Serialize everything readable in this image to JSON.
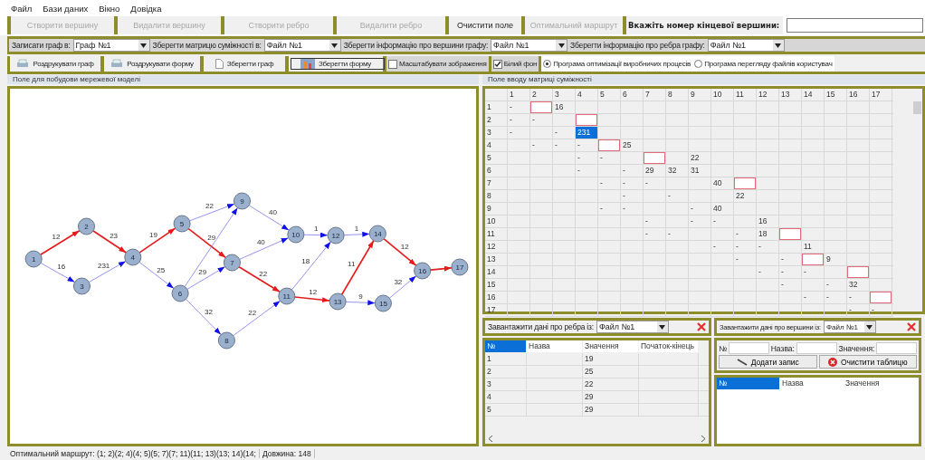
{
  "menu": [
    "Файл",
    "Бази даних",
    "Вікно",
    "Довідка"
  ],
  "toolbar": {
    "buttons": [
      {
        "label": "Створити вершину",
        "disabled": true
      },
      {
        "label": "Видалити вершину",
        "disabled": true
      },
      {
        "label": "Створити ребро",
        "disabled": true
      },
      {
        "label": "Видалити ребро",
        "disabled": true
      },
      {
        "label": "Очистити поле",
        "disabled": false
      },
      {
        "label": "Оптимальний маршрут",
        "disabled": true
      }
    ],
    "target_label": "Вкажіть номер кінцевої вершини:"
  },
  "save_bar": [
    {
      "label": "Записати граф в:",
      "value": "Граф №1"
    },
    {
      "label": "Зберегти матрицю суміжності в:",
      "value": "Файл №1"
    },
    {
      "label": "Зберегти інформацію про вершини графу:",
      "value": "Файл №1"
    },
    {
      "label": "Зберегти інформацію про ребра графу:",
      "value": "Файл №1"
    }
  ],
  "actions": [
    {
      "kind": "print",
      "label": "Роздрукувати граф",
      "pressed": false
    },
    {
      "kind": "print",
      "label": "Роздрукувати форму",
      "pressed": false
    },
    {
      "kind": "document",
      "label": "Зберегти граф",
      "pressed": false
    },
    {
      "kind": "image",
      "label": "Зберегти форму",
      "pressed": true
    }
  ],
  "options": [
    {
      "kind": "checkbox",
      "label": "Масштабувати зображення",
      "checked": false
    },
    {
      "kind": "checkbox",
      "label": "Білий фон",
      "checked": true
    },
    {
      "kind": "radio",
      "label": "Програма оптимізації виробничих процесів",
      "selected": true
    },
    {
      "kind": "radio",
      "label": "Програма перегляду файлів користувач",
      "selected": false
    }
  ],
  "graph_panel": {
    "caption": "Поле для побудови мережевої моделі",
    "nodes": [
      {
        "label": "1"
      },
      {
        "label": "2"
      },
      {
        "label": "3"
      },
      {
        "label": "4"
      },
      {
        "label": "5"
      },
      {
        "label": "6"
      },
      {
        "label": "7"
      },
      {
        "label": "8"
      },
      {
        "label": "9"
      },
      {
        "label": "10"
      },
      {
        "label": "11"
      },
      {
        "label": "12"
      },
      {
        "label": "13"
      },
      {
        "label": "14"
      },
      {
        "label": "15"
      },
      {
        "label": "16"
      },
      {
        "label": "17"
      }
    ],
    "edges": [
      {
        "weight": "12",
        "on_route": true
      },
      {
        "weight": "16",
        "on_route": false
      },
      {
        "weight": "23",
        "on_route": true
      },
      {
        "weight": "231",
        "on_route": false
      },
      {
        "weight": "19",
        "on_route": true
      },
      {
        "weight": "25",
        "on_route": false
      },
      {
        "weight": "22",
        "on_route": false
      },
      {
        "weight": "29",
        "on_route": true
      },
      {
        "on_route": false
      },
      {
        "weight": "29",
        "on_route": false
      },
      {
        "weight": "32",
        "on_route": false
      },
      {
        "weight": "40",
        "on_route": false
      },
      {
        "weight": "22",
        "on_route": true
      },
      {
        "weight": "40",
        "on_route": false
      },
      {
        "weight": "22",
        "on_route": false
      },
      {
        "weight": "1",
        "on_route": false
      },
      {
        "weight": "18",
        "on_route": false
      },
      {
        "weight": "12",
        "on_route": true
      },
      {
        "weight": "1",
        "on_route": false
      },
      {
        "weight": "11",
        "on_route": true
      },
      {
        "weight": "9",
        "on_route": false
      },
      {
        "weight": "12",
        "on_route": true
      },
      {
        "weight": "32",
        "on_route": false
      },
      {
        "on_route": true
      }
    ]
  },
  "matrix_panel": {
    "caption": "Поле вводу матриці суміжності",
    "columns": [
      "1",
      "2",
      "3",
      "4",
      "5",
      "6",
      "7",
      "8",
      "9",
      "10",
      "11",
      "12",
      "13",
      "14",
      "15",
      "16",
      "17"
    ],
    "rows": [
      {
        "label": "1",
        "cells": [
          {
            "kind": "text",
            "text": "-"
          },
          {
            "kind": "marked"
          },
          {
            "kind": "text",
            "text": "16"
          },
          null,
          null,
          null,
          null,
          null,
          null,
          null,
          null,
          null,
          null,
          null,
          null,
          null,
          null
        ]
      },
      {
        "label": "2",
        "cells": [
          {
            "kind": "text",
            "text": "-"
          },
          {
            "kind": "text",
            "text": "-"
          },
          null,
          {
            "kind": "marked"
          },
          null,
          null,
          null,
          null,
          null,
          null,
          null,
          null,
          null,
          null,
          null,
          null,
          null
        ]
      },
      {
        "label": "3",
        "cells": [
          {
            "kind": "text",
            "text": "-"
          },
          null,
          {
            "kind": "text",
            "text": "-"
          },
          {
            "kind": "selected",
            "text": "231"
          },
          null,
          null,
          null,
          null,
          null,
          null,
          null,
          null,
          null,
          null,
          null,
          null,
          null
        ]
      },
      {
        "label": "4",
        "cells": [
          null,
          {
            "kind": "text",
            "text": "-"
          },
          {
            "kind": "text",
            "text": "-"
          },
          {
            "kind": "text",
            "text": "-"
          },
          {
            "kind": "marked"
          },
          {
            "kind": "text",
            "text": "25"
          },
          null,
          null,
          null,
          null,
          null,
          null,
          null,
          null,
          null,
          null,
          null
        ]
      },
      {
        "label": "5",
        "cells": [
          null,
          null,
          null,
          {
            "kind": "text",
            "text": "-"
          },
          {
            "kind": "text",
            "text": "-"
          },
          null,
          {
            "kind": "marked"
          },
          null,
          {
            "kind": "text",
            "text": "22"
          },
          null,
          null,
          null,
          null,
          null,
          null,
          null,
          null
        ]
      },
      {
        "label": "6",
        "cells": [
          null,
          null,
          null,
          {
            "kind": "text",
            "text": "-"
          },
          null,
          {
            "kind": "text",
            "text": "-"
          },
          {
            "kind": "text",
            "text": "29"
          },
          {
            "kind": "text",
            "text": "32"
          },
          {
            "kind": "text",
            "text": "31"
          },
          null,
          null,
          null,
          null,
          null,
          null,
          null,
          null
        ]
      },
      {
        "label": "7",
        "cells": [
          null,
          null,
          null,
          null,
          {
            "kind": "text",
            "text": "-"
          },
          {
            "kind": "text",
            "text": "-"
          },
          {
            "kind": "text",
            "text": "-"
          },
          null,
          null,
          {
            "kind": "text",
            "text": "40"
          },
          {
            "kind": "marked"
          },
          null,
          null,
          null,
          null,
          null,
          null
        ]
      },
      {
        "label": "8",
        "cells": [
          null,
          null,
          null,
          null,
          null,
          {
            "kind": "text",
            "text": "-"
          },
          null,
          {
            "kind": "text",
            "text": "-"
          },
          null,
          null,
          {
            "kind": "text",
            "text": "22"
          },
          null,
          null,
          null,
          null,
          null,
          null
        ]
      },
      {
        "label": "9",
        "cells": [
          null,
          null,
          null,
          null,
          {
            "kind": "text",
            "text": "-"
          },
          {
            "kind": "text",
            "text": "-"
          },
          null,
          null,
          {
            "kind": "text",
            "text": "-"
          },
          {
            "kind": "text",
            "text": "40"
          },
          null,
          null,
          null,
          null,
          null,
          null,
          null
        ]
      },
      {
        "label": "10",
        "cells": [
          null,
          null,
          null,
          null,
          null,
          null,
          {
            "kind": "text",
            "text": "-"
          },
          null,
          {
            "kind": "text",
            "text": "-"
          },
          {
            "kind": "text",
            "text": "-"
          },
          null,
          {
            "kind": "text",
            "text": "16"
          },
          null,
          null,
          null,
          null,
          null
        ]
      },
      {
        "label": "11",
        "cells": [
          null,
          null,
          null,
          null,
          null,
          null,
          {
            "kind": "text",
            "text": "-"
          },
          {
            "kind": "text",
            "text": "-"
          },
          null,
          null,
          {
            "kind": "text",
            "text": "-"
          },
          {
            "kind": "text",
            "text": "18"
          },
          {
            "kind": "marked"
          },
          null,
          null,
          null,
          null
        ]
      },
      {
        "label": "12",
        "cells": [
          null,
          null,
          null,
          null,
          null,
          null,
          null,
          null,
          null,
          {
            "kind": "text",
            "text": "-"
          },
          {
            "kind": "text",
            "text": "-"
          },
          {
            "kind": "text",
            "text": "-"
          },
          null,
          {
            "kind": "text",
            "text": "11"
          },
          null,
          null,
          null
        ]
      },
      {
        "label": "13",
        "cells": [
          null,
          null,
          null,
          null,
          null,
          null,
          null,
          null,
          null,
          null,
          {
            "kind": "text",
            "text": "-"
          },
          null,
          {
            "kind": "text",
            "text": "-"
          },
          {
            "kind": "marked"
          },
          {
            "kind": "text",
            "text": "9"
          },
          null,
          null
        ]
      },
      {
        "label": "14",
        "cells": [
          null,
          null,
          null,
          null,
          null,
          null,
          null,
          null,
          null,
          null,
          null,
          {
            "kind": "text",
            "text": "-"
          },
          {
            "kind": "text",
            "text": "-"
          },
          {
            "kind": "text",
            "text": "-"
          },
          null,
          {
            "kind": "marked"
          },
          null
        ]
      },
      {
        "label": "15",
        "cells": [
          null,
          null,
          null,
          null,
          null,
          null,
          null,
          null,
          null,
          null,
          null,
          null,
          {
            "kind": "text",
            "text": "-"
          },
          null,
          {
            "kind": "text",
            "text": "-"
          },
          {
            "kind": "text",
            "text": "32"
          },
          null
        ]
      },
      {
        "label": "16",
        "cells": [
          null,
          null,
          null,
          null,
          null,
          null,
          null,
          null,
          null,
          null,
          null,
          null,
          null,
          {
            "kind": "text",
            "text": "-"
          },
          {
            "kind": "text",
            "text": "-"
          },
          {
            "kind": "text",
            "text": "-"
          },
          {
            "kind": "marked"
          }
        ]
      },
      {
        "label": "17",
        "cells": [
          null,
          null,
          null,
          null,
          null,
          null,
          null,
          null,
          null,
          null,
          null,
          null,
          null,
          null,
          null,
          {
            "kind": "text",
            "text": "-"
          },
          {
            "kind": "text",
            "text": "-"
          }
        ]
      }
    ]
  },
  "edges_panel": {
    "load_label": "Завантажити дані про ребра із:",
    "file": "Файл №1",
    "columns": [
      "№",
      "Назва",
      "Значення",
      "Початок-кінець"
    ],
    "rows": [
      {
        "number": "1",
        "value": "19"
      },
      {
        "number": "2",
        "value": "25"
      },
      {
        "number": "3",
        "value": "22"
      },
      {
        "number": "4",
        "value": "29"
      },
      {
        "number": "5",
        "value": "29"
      }
    ]
  },
  "vertices_panel": {
    "load_label": "Завантажити дані про вершини із:",
    "file": "Файл №1",
    "fields": [
      "№",
      "Назва:",
      "Значення:"
    ],
    "buttons": [
      {
        "kind": "add",
        "label": "Додати запис"
      },
      {
        "kind": "clear",
        "label": "Очистити таблицю"
      }
    ],
    "columns": [
      "№",
      "Назва",
      "Значення"
    ]
  },
  "status_bar": {
    "route": "Оптимальний маршрут: (1; 2)(2; 4)(4; 5)(5; 7)(7; 11)(11; 13)(13; 14)(14;",
    "length": "Довжина: 148"
  }
}
